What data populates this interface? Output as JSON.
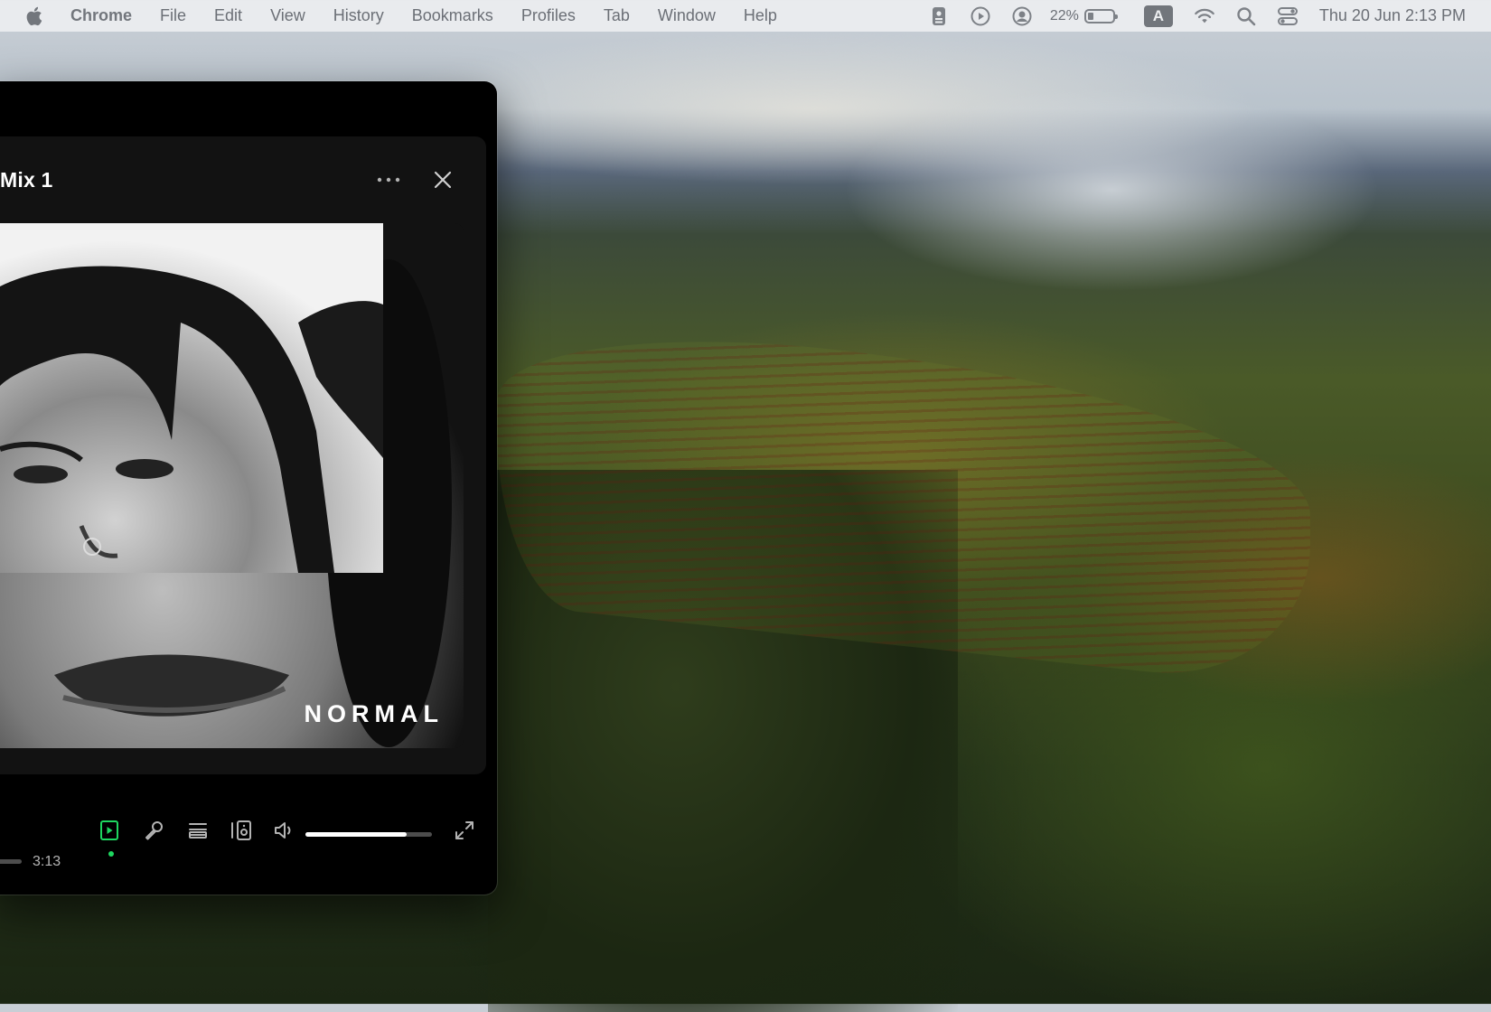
{
  "menubar": {
    "apple_icon": "apple-logo-icon",
    "app_name": "Chrome",
    "menus": [
      "File",
      "Edit",
      "View",
      "History",
      "Bookmarks",
      "Profiles",
      "Tab",
      "Window",
      "Help"
    ],
    "status": {
      "battery_percent": "22%",
      "battery_level": 0.22,
      "input_source": "A",
      "clock": "Thu 20 Jun  2:13 PM"
    }
  },
  "player": {
    "panel_title": "Mix 1",
    "cover_text": "NORMAL",
    "duration": "3:13",
    "volume_level": 0.8,
    "accent_color": "#1ed760",
    "controls": [
      "now-playing-view-icon",
      "lyrics-mic-icon",
      "queue-icon",
      "connect-device-icon",
      "volume-icon",
      "fullscreen-icon"
    ]
  }
}
